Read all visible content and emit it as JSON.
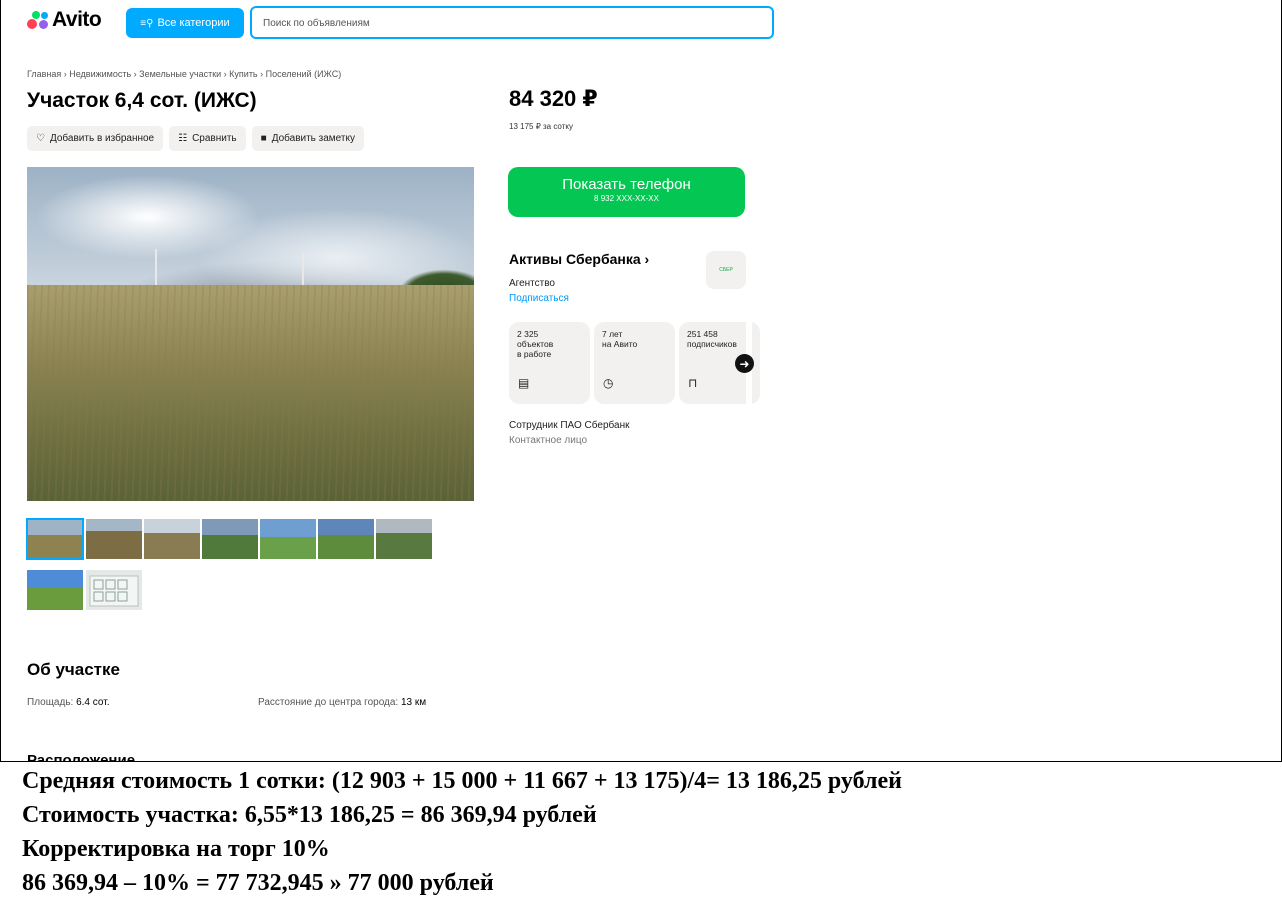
{
  "header": {
    "logo": "Avito",
    "categories_button": "Все категории",
    "search_placeholder": "Поиск по объявлениям"
  },
  "breadcrumbs": "Главная › Недвижимость › Земельные участки › Купить › Поселений (ИЖС)",
  "listing": {
    "title": "Участок 6,4 сот. (ИЖС)",
    "actions": [
      "Добавить в избранное",
      "Сравнить",
      "Добавить заметку"
    ],
    "price": "84 320 ₽",
    "price_per_unit": "13 175 ₽ за сотку",
    "phone_button": "Показать телефон",
    "phone_masked": "8 932 XXX-XX-XX",
    "thumbnail_count": 9
  },
  "seller": {
    "name": "Активы Сбербанка ›",
    "type": "Агентство",
    "subscribe": "Подписаться",
    "logo_text": "СБЕР",
    "stats": [
      {
        "value": "2 325",
        "label": "объектов\nв работе",
        "icon": "listing-icon"
      },
      {
        "value": "7 лет",
        "label": "на Авито",
        "icon": "clock-icon"
      },
      {
        "value": "251 458",
        "label": "подписчиков",
        "icon": "bookmark-icon"
      }
    ],
    "contact_name": "Сотрудник ПАО Сбербанк",
    "contact_role": "Контактное лицо"
  },
  "about": {
    "heading": "Об участке",
    "area_label": "Площадь:",
    "area_value": "6.4 сот.",
    "distance_label": "Расстояние до центра города:",
    "distance_value": "13 км",
    "location_heading": "Расположение"
  },
  "calculation": [
    "Средняя стоимость 1 сотки: (12 903 + 15 000 + 11 667 + 13 175)/4= 13 186,25 рублей",
    "Стоимость участка: 6,55*13 186,25 = 86 369,94 рублей",
    "Корректировка на торг 10%",
    "86 369,94 – 10% = 77 732,945 » 77 000 рублей"
  ],
  "colors": {
    "accent_blue": "#00aaff",
    "phone_green": "#04c753",
    "link_blue": "#0099f7"
  }
}
